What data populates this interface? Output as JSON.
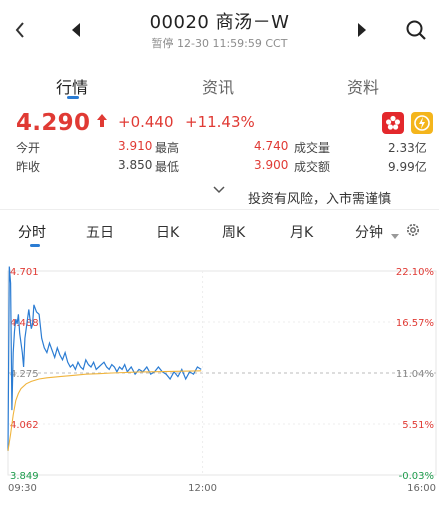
{
  "header": {
    "title": "00020 商汤－W",
    "status": "暂停",
    "datetime": "12-30 11:59:59 CCT"
  },
  "tabs": [
    "行情",
    "资讯",
    "资料"
  ],
  "quote": {
    "price": "4.290",
    "change": "+0.440",
    "change_pct": "+11.43%",
    "rows": [
      {
        "l1": "今开",
        "v1": "3.910",
        "l2": "最高",
        "v2": "4.740",
        "l3": "成交量",
        "v3": "2.33亿"
      },
      {
        "l1": "昨收",
        "v1": "3.850",
        "l2": "最低",
        "v2": "3.900",
        "l3": "成交额",
        "v3": "9.99亿"
      }
    ]
  },
  "risk_notice": "投资有风险，入市需谨慎",
  "period_tabs": [
    "分时",
    "五日",
    "日K",
    "周K",
    "月K",
    "分钟"
  ],
  "colors": {
    "up": "#e03a34",
    "down": "#1d9b4c",
    "accent": "#2b7cd3",
    "avg_line": "#f0b43c"
  },
  "chart_data": {
    "type": "line",
    "y_left_ticks": [
      "4.701",
      "4.488",
      "4.275",
      "4.062",
      "3.849"
    ],
    "y_right_ticks": [
      "22.10%",
      "16.57%",
      "11.04%",
      "5.51%",
      "-0.03%"
    ],
    "x_ticks": [
      "09:30",
      "12:00",
      "16:00"
    ],
    "ylim": [
      3.849,
      4.701
    ],
    "reference_price": 3.85,
    "series": [
      {
        "color": "#2b7cd3",
        "x": [
          0,
          1,
          2,
          3,
          4,
          5,
          6,
          7,
          8,
          9,
          10,
          11,
          12,
          13,
          14,
          15,
          16,
          17,
          18,
          19,
          20,
          22,
          24,
          26,
          28,
          30,
          32,
          34,
          36,
          38,
          40,
          42,
          44,
          46,
          48,
          50,
          52,
          54,
          56,
          58,
          60,
          62,
          64,
          66,
          68,
          70,
          72,
          74,
          76,
          78,
          80,
          82,
          84,
          86,
          88,
          90,
          92,
          95,
          98,
          101,
          104,
          107,
          110,
          113,
          116,
          119,
          122,
          125,
          128,
          131,
          134,
          137,
          140,
          143,
          146,
          149
        ],
        "values": [
          3.95,
          4.72,
          4.65,
          4.12,
          4.36,
          4.45,
          4.5,
          4.48,
          4.52,
          4.44,
          4.4,
          4.36,
          4.3,
          4.42,
          4.46,
          4.5,
          4.54,
          4.5,
          4.46,
          4.48,
          4.56,
          4.53,
          4.52,
          4.42,
          4.38,
          4.36,
          4.4,
          4.37,
          4.34,
          4.38,
          4.35,
          4.33,
          4.36,
          4.32,
          4.3,
          4.31,
          4.29,
          4.32,
          4.3,
          4.29,
          4.33,
          4.31,
          4.3,
          4.32,
          4.29,
          4.3,
          4.31,
          4.32,
          4.3,
          4.29,
          4.31,
          4.3,
          4.28,
          4.3,
          4.29,
          4.31,
          4.28,
          4.3,
          4.27,
          4.29,
          4.28,
          4.3,
          4.27,
          4.28,
          4.3,
          4.28,
          4.27,
          4.25,
          4.28,
          4.26,
          4.29,
          4.25,
          4.28,
          4.27,
          4.3,
          4.29
        ]
      },
      {
        "color": "#f0b43c",
        "x": [
          0,
          2,
          4,
          6,
          8,
          10,
          14,
          18,
          24,
          30,
          40,
          50,
          60,
          70,
          80,
          90,
          100,
          110,
          120,
          130,
          140,
          149
        ],
        "values": [
          3.95,
          4.02,
          4.1,
          4.16,
          4.19,
          4.21,
          4.23,
          4.24,
          4.25,
          4.255,
          4.26,
          4.265,
          4.27,
          4.272,
          4.275,
          4.277,
          4.279,
          4.28,
          4.281,
          4.282,
          4.283,
          4.284
        ]
      }
    ]
  }
}
